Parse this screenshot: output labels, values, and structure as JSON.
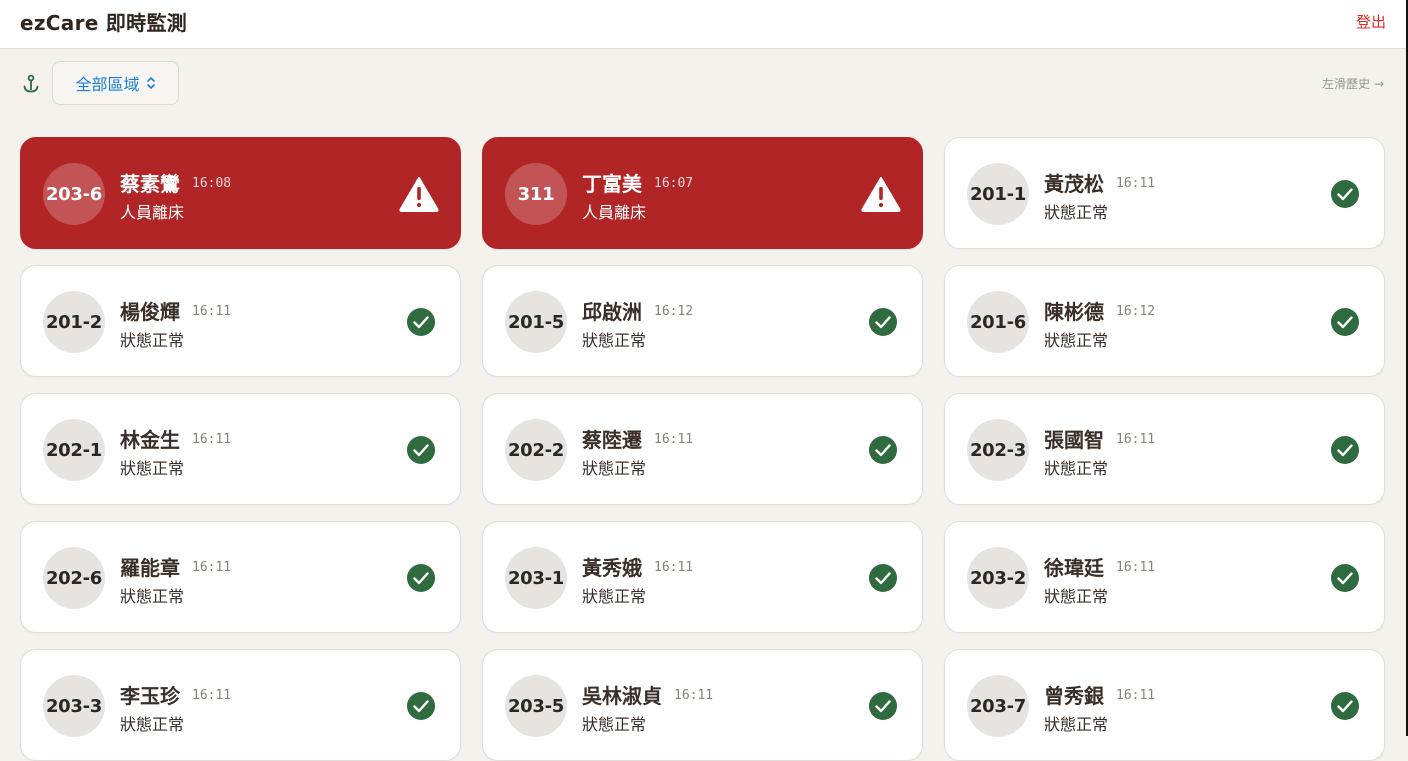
{
  "app": {
    "title": "ezCare 即時監測",
    "logout_label": "登出"
  },
  "filter": {
    "zone_label": "全部區域",
    "history_hint": "左滑歷史 →"
  },
  "icons": {
    "anchor": "anchor-icon",
    "chevron": "chevron-updown-icon",
    "alert": "warning-triangle-icon",
    "ok": "check-circle-icon"
  },
  "colors": {
    "alert_bg": "#b22527",
    "ok_green": "#2f6b3f",
    "accent_blue": "#1a7fd6",
    "logout_red": "#e02b2b"
  },
  "residents": [
    {
      "room": "203-6",
      "name": "蔡素鸞",
      "time": "16:08",
      "status": "人員離床",
      "alert": true
    },
    {
      "room": "311",
      "name": "丁富美",
      "time": "16:07",
      "status": "人員離床",
      "alert": true
    },
    {
      "room": "201-1",
      "name": "黃茂松",
      "time": "16:11",
      "status": "狀態正常",
      "alert": false
    },
    {
      "room": "201-2",
      "name": "楊俊輝",
      "time": "16:11",
      "status": "狀態正常",
      "alert": false
    },
    {
      "room": "201-5",
      "name": "邱啟洲",
      "time": "16:12",
      "status": "狀態正常",
      "alert": false
    },
    {
      "room": "201-6",
      "name": "陳彬德",
      "time": "16:12",
      "status": "狀態正常",
      "alert": false
    },
    {
      "room": "202-1",
      "name": "林金生",
      "time": "16:11",
      "status": "狀態正常",
      "alert": false
    },
    {
      "room": "202-2",
      "name": "蔡陸遷",
      "time": "16:11",
      "status": "狀態正常",
      "alert": false
    },
    {
      "room": "202-3",
      "name": "張國智",
      "time": "16:11",
      "status": "狀態正常",
      "alert": false
    },
    {
      "room": "202-6",
      "name": "羅能章",
      "time": "16:11",
      "status": "狀態正常",
      "alert": false
    },
    {
      "room": "203-1",
      "name": "黃秀娥",
      "time": "16:11",
      "status": "狀態正常",
      "alert": false
    },
    {
      "room": "203-2",
      "name": "徐瑋廷",
      "time": "16:11",
      "status": "狀態正常",
      "alert": false
    },
    {
      "room": "203-3",
      "name": "李玉珍",
      "time": "16:11",
      "status": "狀態正常",
      "alert": false
    },
    {
      "room": "203-5",
      "name": "吳林淑貞",
      "time": "16:11",
      "status": "狀態正常",
      "alert": false
    },
    {
      "room": "203-7",
      "name": "曾秀銀",
      "time": "16:11",
      "status": "狀態正常",
      "alert": false
    }
  ]
}
